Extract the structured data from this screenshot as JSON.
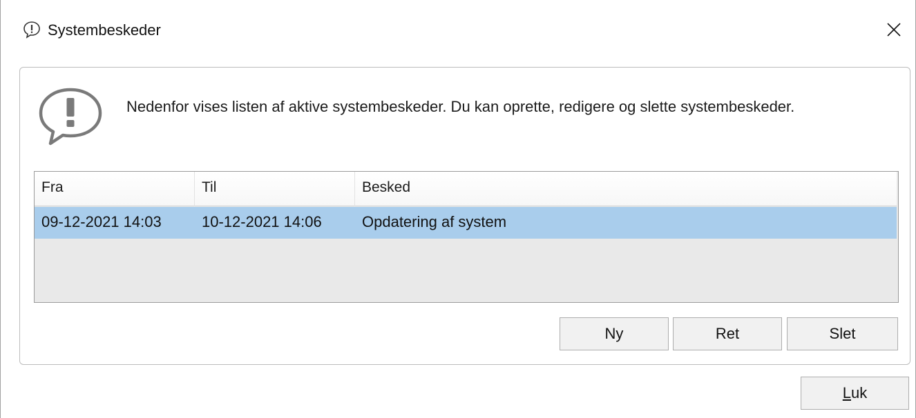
{
  "window": {
    "title": "Systembeskeder",
    "title_icon": "message-exclamation-icon",
    "close_icon": "close-icon"
  },
  "info": {
    "icon": "speech-exclamation-icon",
    "text": "Nedenfor vises listen af aktive systembeskeder. Du kan oprette, redigere og slette systembeskeder."
  },
  "grid": {
    "columns": [
      "Fra",
      "Til",
      "Besked"
    ],
    "rows": [
      {
        "fra": "09-12-2021 14:03",
        "til": "10-12-2021 14:06",
        "besked": "Opdatering af system",
        "selected": true
      }
    ]
  },
  "buttons": {
    "ny": "Ny",
    "ret": "Ret",
    "slet": "Slet",
    "luk_mnemonic": "L",
    "luk_rest": "uk"
  },
  "colors": {
    "selection": "#a9cdec",
    "grid_background": "#e9e9e9",
    "button_face": "#f1f1f1"
  }
}
